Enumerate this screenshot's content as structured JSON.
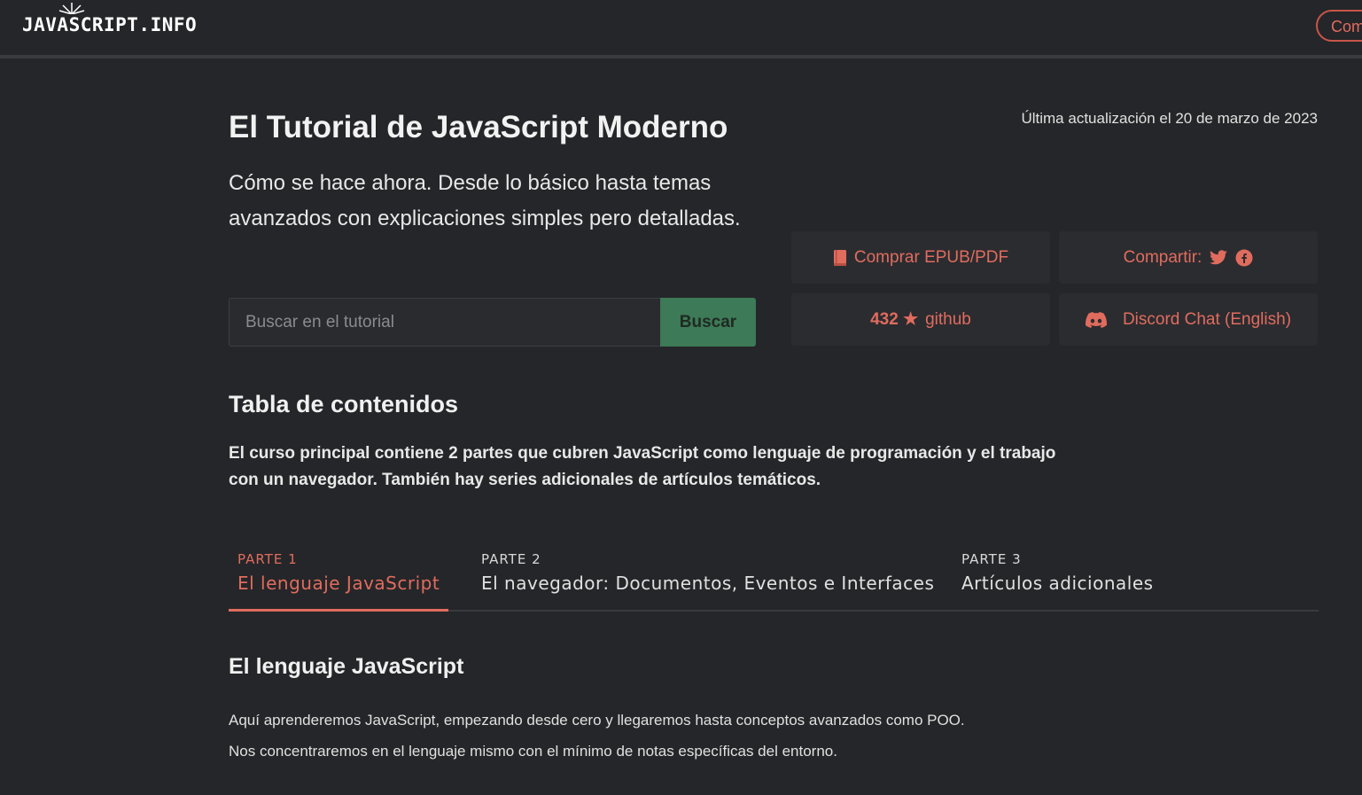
{
  "header": {
    "logo": "JAVASCRIPT.INFO",
    "right_button": "Com"
  },
  "hero": {
    "title": "El Tutorial de JavaScript Moderno",
    "updated": "Última actualización el 20 de marzo de 2023",
    "subtitle": "Cómo se hace ahora. Desde lo básico hasta temas avanzados con explicaciones simples pero detalladas."
  },
  "search": {
    "placeholder": "Buscar en el tutorial",
    "button": "Buscar"
  },
  "actions": {
    "buy": "Comprar EPUB/PDF",
    "share": "Compartir:",
    "stars": "432 ★",
    "github": "github",
    "discord": "Discord Chat (English)"
  },
  "toc": {
    "title": "Tabla de contenidos",
    "description": "El curso principal contiene 2 partes que cubren JavaScript como lenguaje de programación y el trabajo con un navegador. También hay series adicionales de artículos temáticos.",
    "tabs": [
      {
        "num": "PARTE 1",
        "label": "El lenguaje JavaScript"
      },
      {
        "num": "PARTE 2",
        "label": "El navegador: Documentos, Eventos e Interfaces"
      },
      {
        "num": "PARTE 3",
        "label": "Artículos adicionales"
      }
    ]
  },
  "section": {
    "title": "El lenguaje JavaScript",
    "para1": "Aquí aprenderemos JavaScript, empezando desde cero y llegaremos hasta conceptos avanzados como POO.",
    "para2": "Nos concentraremos en el lenguaje mismo con el mínimo de notas específicas del entorno."
  },
  "colors": {
    "background": "#252629",
    "accent": "#e06c5e",
    "search_button": "#3d7a57"
  },
  "icons": [
    "book-icon",
    "twitter-icon",
    "facebook-icon",
    "discord-icon"
  ]
}
